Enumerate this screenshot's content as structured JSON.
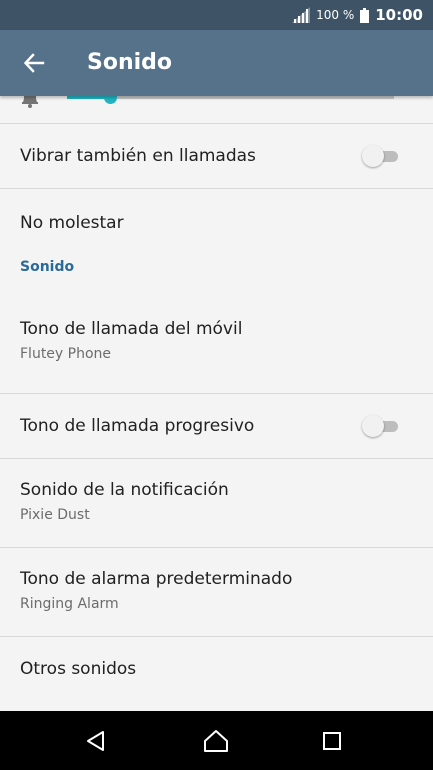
{
  "status_bar": {
    "battery_percent": "100 %",
    "time": "10:00",
    "signal_icon": "signal-icon",
    "battery_icon": "battery-icon"
  },
  "app_bar": {
    "title": "Sonido",
    "back_icon": "back-arrow-icon",
    "color": "#55728a"
  },
  "volume": {
    "level": 0.13,
    "accent": "#1fb5c4",
    "icon": "bell-icon"
  },
  "items": [
    {
      "title": "Vibrar también en llamadas",
      "toggle": false
    },
    {
      "title": "No molestar"
    },
    {
      "section": "Sonido"
    },
    {
      "title": "Tono de llamada del móvil",
      "subtitle": "Flutey Phone"
    },
    {
      "title": "Tono de llamada progresivo",
      "toggle": false
    },
    {
      "title": "Sonido de la notificación",
      "subtitle": "Pixie Dust"
    },
    {
      "title": "Tono de alarma predeterminado",
      "subtitle": "Ringing Alarm"
    },
    {
      "title": "Otros sonidos"
    }
  ],
  "nav_bar": {
    "back_icon": "nav-back-icon",
    "home_icon": "nav-home-icon",
    "recents_icon": "nav-recents-icon"
  }
}
